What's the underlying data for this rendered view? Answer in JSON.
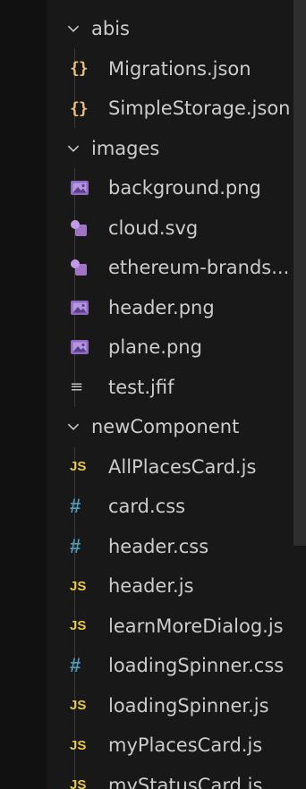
{
  "tree": {
    "rows": [
      {
        "kind": "folder",
        "name": "abis",
        "icon": "chevron-down-icon"
      },
      {
        "kind": "file",
        "name": "Migrations.json",
        "icon": "json-file-icon",
        "glyph": "{}"
      },
      {
        "kind": "file",
        "name": "SimpleStorage.json",
        "icon": "json-file-icon",
        "glyph": "{}"
      },
      {
        "kind": "folder",
        "name": "images",
        "icon": "chevron-down-icon"
      },
      {
        "kind": "file",
        "name": "background.png",
        "icon": "image-file-icon"
      },
      {
        "kind": "file",
        "name": "cloud.svg",
        "icon": "svg-file-icon"
      },
      {
        "kind": "file",
        "name": "ethereum-brands...",
        "icon": "svg-file-icon"
      },
      {
        "kind": "file",
        "name": "header.png",
        "icon": "image-file-icon"
      },
      {
        "kind": "file",
        "name": "plane.png",
        "icon": "image-file-icon"
      },
      {
        "kind": "file",
        "name": "test.jfif",
        "icon": "text-file-icon",
        "glyph": "≡"
      },
      {
        "kind": "folder",
        "name": "newComponent",
        "icon": "chevron-down-icon"
      },
      {
        "kind": "file",
        "name": "AllPlacesCard.js",
        "icon": "javascript-file-icon",
        "glyph": "JS"
      },
      {
        "kind": "file",
        "name": "card.css",
        "icon": "css-file-icon",
        "glyph": "#"
      },
      {
        "kind": "file",
        "name": "header.css",
        "icon": "css-file-icon",
        "glyph": "#"
      },
      {
        "kind": "file",
        "name": "header.js",
        "icon": "javascript-file-icon",
        "glyph": "JS"
      },
      {
        "kind": "file",
        "name": "learnMoreDialog.js",
        "icon": "javascript-file-icon",
        "glyph": "JS"
      },
      {
        "kind": "file",
        "name": "loadingSpinner.css",
        "icon": "css-file-icon",
        "glyph": "#"
      },
      {
        "kind": "file",
        "name": "loadingSpinner.js",
        "icon": "javascript-file-icon",
        "glyph": "JS"
      },
      {
        "kind": "file",
        "name": "myPlacesCard.js",
        "icon": "javascript-file-icon",
        "glyph": "JS"
      },
      {
        "kind": "file",
        "name": "myStatusCard.js",
        "icon": "javascript-file-icon",
        "glyph": "JS"
      }
    ]
  },
  "colors": {
    "background": "#181818",
    "text": "#cccccc",
    "json": "#e5c07b",
    "javascript": "#e6c84a",
    "css": "#519aba",
    "image": "#a074c4",
    "svg": "#b48ee6"
  }
}
